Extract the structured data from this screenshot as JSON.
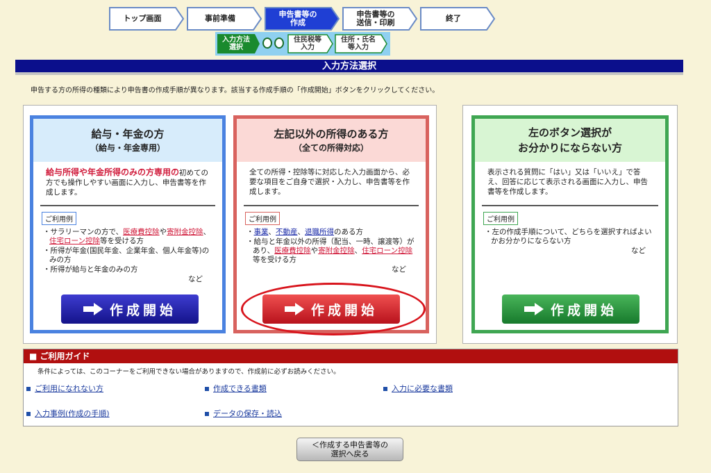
{
  "steps": [
    {
      "label": "トップ画面",
      "active": false
    },
    {
      "label": "事前準備",
      "active": false
    },
    {
      "label": "申告書等の\n作成",
      "active": true
    },
    {
      "label": "申告書等の\n送信・印刷",
      "active": false
    },
    {
      "label": "終了",
      "active": false
    }
  ],
  "substeps": [
    {
      "label": "入力方法\n選択",
      "active": true
    },
    {
      "label": "住民税等\n入力",
      "active": false
    },
    {
      "label": "住所・氏名\n等入力",
      "active": false
    }
  ],
  "title": "入力方法選択",
  "instruction": "申告する方の所得の種類により申告書の作成手順が異なります。該当する作成手順の「作成開始」ボタンをクリックしてください。",
  "cards": {
    "salary": {
      "title": "給与・年金の方",
      "subtitle": "（給与・年金専用）",
      "desc_red": "給与所得や年金所得のみの方専用の",
      "desc": "初めての方でも操作しやすい画面に入力し、申告書等を作成します。",
      "usage_label": "ご利用例",
      "u1a": "サラリーマンの方で、",
      "u1b": "医療費控除",
      "u1c": "や",
      "u1d": "寄附金控除",
      "u1e": "、",
      "u1f": "住宅ローン控除",
      "u1g": "等を受ける方",
      "u2": "所得が年金(国民年金、企業年金、個人年金等)のみの方",
      "u3": "所得が給与と年金のみの方",
      "nado": "など",
      "button": "作成開始"
    },
    "other": {
      "title": "左記以外の所得のある方",
      "subtitle": "（全ての所得対応）",
      "desc": "全ての所得・控除等に対応した入力画面から、必要な項目をご自身で選択・入力し、申告書等を作成します。",
      "usage_label": "ご利用例",
      "u1a": "事業",
      "u1b": "、",
      "u1c": "不動産",
      "u1d": "、",
      "u1e": "退職所得",
      "u1f": "のある方",
      "u2a": "給与と年金以外の所得（配当、一時、譲渡等）があり、",
      "u2b": "医療費控除",
      "u2c": "や",
      "u2d": "寄附金控除",
      "u2e": "、",
      "u2f": "住宅ローン控除",
      "u2g": "等を受ける方",
      "nado": "など",
      "button": "作成開始"
    },
    "unsure": {
      "title_line1": "左のボタン選択が",
      "title_line2": "お分かりにならない方",
      "desc": "表示される質問に「はい」又は「いいえ」で答え、回答に応じて表示される画面に入力し、申告書等を作成します。",
      "usage_label": "ご利用例",
      "u1": "左の作成手順について、どちらを選択すればよいかお分かりにならない方",
      "nado": "など",
      "button": "作成開始"
    }
  },
  "guide": {
    "title": "ご利用ガイド",
    "note": "条件によっては、このコーナーをご利用できない場合がありますので、作成前に必ずお読みください。",
    "links": [
      "ご利用になれない方",
      "作成できる書類",
      "入力に必要な書類",
      "入力事例(作成の手順)",
      "データの保存・読込"
    ]
  },
  "back_button": "＜作成する申告書等の\n選択へ戻る",
  "colors": {
    "title_bar": "#0b0f8c",
    "guide_bar": "#b10f0f",
    "blue": "#4a82e0",
    "red": "#d8625e",
    "green": "#3fa652"
  }
}
